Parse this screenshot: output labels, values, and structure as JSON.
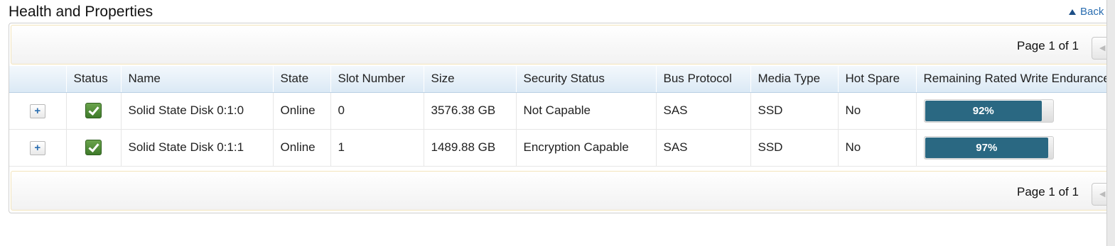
{
  "page": {
    "title": "Health and Properties",
    "back_label": "Back"
  },
  "pager": {
    "top_text": "Page 1 of 1",
    "bottom_text": "Page 1 of 1",
    "prev_icon": "chevron-left-icon"
  },
  "table": {
    "columns": [
      "",
      "Status",
      "Name",
      "State",
      "Slot Number",
      "Size",
      "Security Status",
      "Bus Protocol",
      "Media Type",
      "Hot Spare",
      "Remaining Rated Write Endurance"
    ],
    "rows": [
      {
        "expand": "+",
        "status": "ok",
        "name": "Solid State Disk 0:1:0",
        "state": "Online",
        "slot": "0",
        "size": "3576.38 GB",
        "security": "Not Capable",
        "bus": "SAS",
        "media": "SSD",
        "hot_spare": "No",
        "endurance_label": "92%",
        "endurance_value": 92
      },
      {
        "expand": "+",
        "status": "ok",
        "name": "Solid State Disk 0:1:1",
        "state": "Online",
        "slot": "1",
        "size": "1489.88 GB",
        "security": "Encryption Capable",
        "bus": "SAS",
        "media": "SSD",
        "hot_spare": "No",
        "endurance_label": "97%",
        "endurance_value": 97
      }
    ]
  },
  "colors": {
    "status_ok": "#4e8a35",
    "endurance_bar": "#2a6882",
    "header_bg": "#dbe9f5",
    "link": "#2a6db0"
  }
}
